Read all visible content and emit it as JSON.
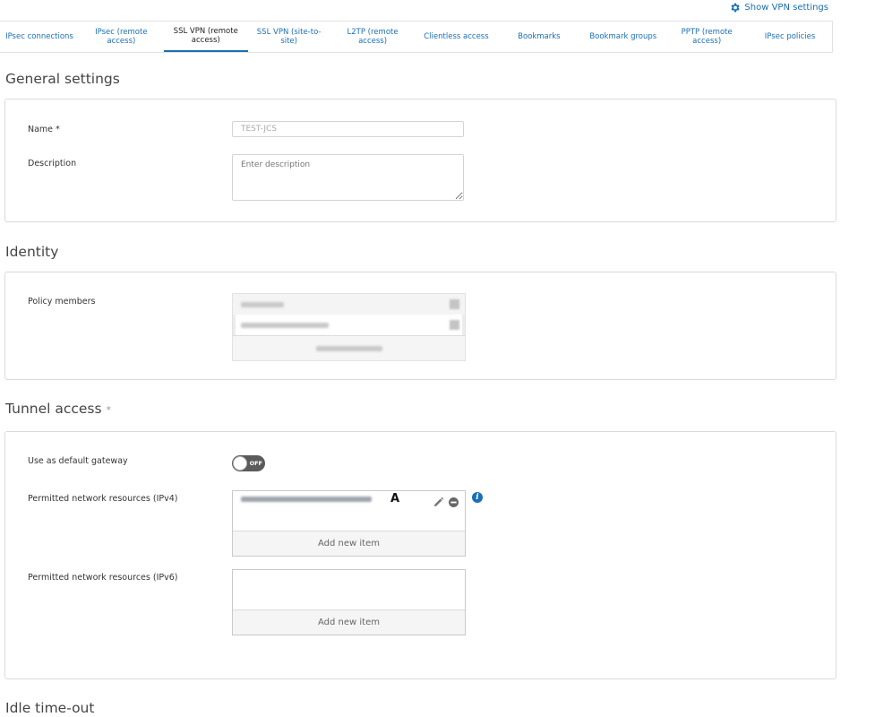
{
  "header": {
    "show_vpn_settings": "Show VPN settings"
  },
  "tabs": [
    {
      "label": "IPsec connections",
      "active": false
    },
    {
      "label": "IPsec (remote access)",
      "active": false
    },
    {
      "label": "SSL VPN (remote access)",
      "active": true
    },
    {
      "label": "SSL VPN (site-to-site)",
      "active": false
    },
    {
      "label": "L2TP (remote access)",
      "active": false
    },
    {
      "label": "Clientless access",
      "active": false
    },
    {
      "label": "Bookmarks",
      "active": false
    },
    {
      "label": "Bookmark groups",
      "active": false
    },
    {
      "label": "PPTP (remote access)",
      "active": false
    },
    {
      "label": "IPsec policies",
      "active": false
    }
  ],
  "general": {
    "title": "General settings",
    "name_label": "Name *",
    "name_value": "TEST-JCS",
    "description_label": "Description",
    "description_placeholder": "Enter description"
  },
  "identity": {
    "title": "Identity",
    "policy_members_label": "Policy members"
  },
  "tunnel": {
    "title": "Tunnel access",
    "required_mark": "*",
    "default_gateway_label": "Use as default gateway",
    "toggle_state": "OFF",
    "ipv4_label": "Permitted network resources (IPv4)",
    "ipv6_label": "Permitted network resources (IPv6)",
    "add_new_item": "Add new item",
    "cursor_glyph": "A"
  },
  "idle": {
    "title": "Idle time-out"
  },
  "colors": {
    "accent": "#1a6fb5",
    "toggle_off": "#5b5b5b"
  }
}
